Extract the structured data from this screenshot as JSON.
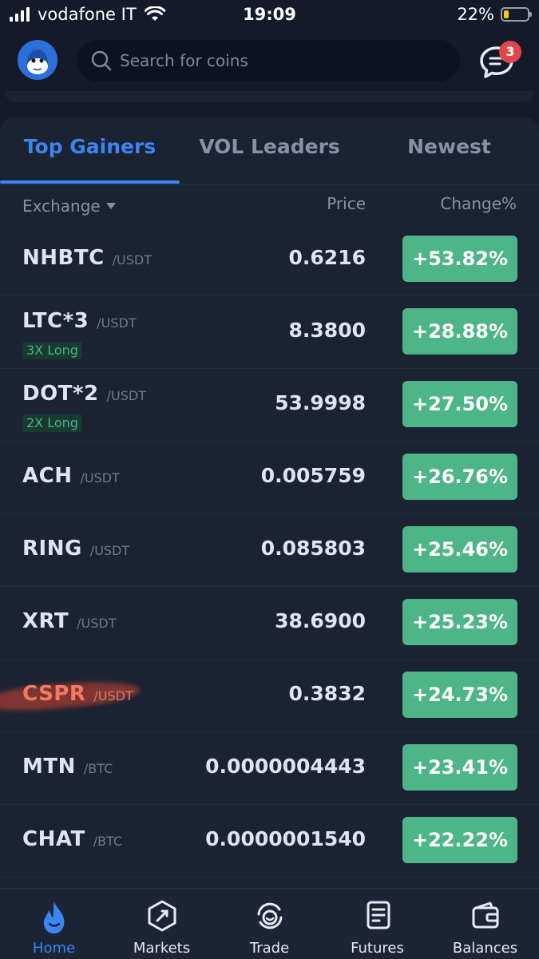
{
  "status_bar": {
    "carrier": "vodafone IT",
    "time": "19:09",
    "battery_percent": "22%",
    "battery_level": 0.22
  },
  "header": {
    "search_placeholder": "Search for coins",
    "notification_count": "3"
  },
  "tabs": [
    {
      "label": "Top Gainers",
      "active": true
    },
    {
      "label": "VOL Leaders",
      "active": false
    },
    {
      "label": "Newest",
      "active": false
    }
  ],
  "columns": {
    "exchange": "Exchange",
    "price": "Price",
    "change": "Change%"
  },
  "rows": [
    {
      "symbol": "NHBTC",
      "quote": "/USDT",
      "tag": "",
      "price": "0.6216",
      "change": "+53.82%"
    },
    {
      "symbol": "LTC*3",
      "quote": "/USDT",
      "tag": "3X Long",
      "price": "8.3800",
      "change": "+28.88%"
    },
    {
      "symbol": "DOT*2",
      "quote": "/USDT",
      "tag": "2X Long",
      "price": "53.9998",
      "change": "+27.50%"
    },
    {
      "symbol": "ACH",
      "quote": "/USDT",
      "tag": "",
      "price": "0.005759",
      "change": "+26.76%"
    },
    {
      "symbol": "RING",
      "quote": "/USDT",
      "tag": "",
      "price": "0.085803",
      "change": "+25.46%"
    },
    {
      "symbol": "XRT",
      "quote": "/USDT",
      "tag": "",
      "price": "38.6900",
      "change": "+25.23%"
    },
    {
      "symbol": "CSPR",
      "quote": "/USDT",
      "tag": "",
      "price": "0.3832",
      "change": "+24.73%"
    },
    {
      "symbol": "MTN",
      "quote": "/BTC",
      "tag": "",
      "price": "0.0000004443",
      "change": "+23.41%"
    },
    {
      "symbol": "CHAT",
      "quote": "/BTC",
      "tag": "",
      "price": "0.0000001540",
      "change": "+22.22%"
    }
  ],
  "nav": [
    {
      "label": "Home",
      "icon": "flame-icon",
      "active": true
    },
    {
      "label": "Markets",
      "icon": "compass-icon",
      "active": false
    },
    {
      "label": "Trade",
      "icon": "swap-icon",
      "active": false
    },
    {
      "label": "Futures",
      "icon": "document-icon",
      "active": false
    },
    {
      "label": "Balances",
      "icon": "wallet-icon",
      "active": false
    }
  ],
  "colors": {
    "background": "#141a2a",
    "card": "#1b2232",
    "accent": "#3b86f2",
    "positive": "#4db587",
    "badge": "#e0474c"
  }
}
